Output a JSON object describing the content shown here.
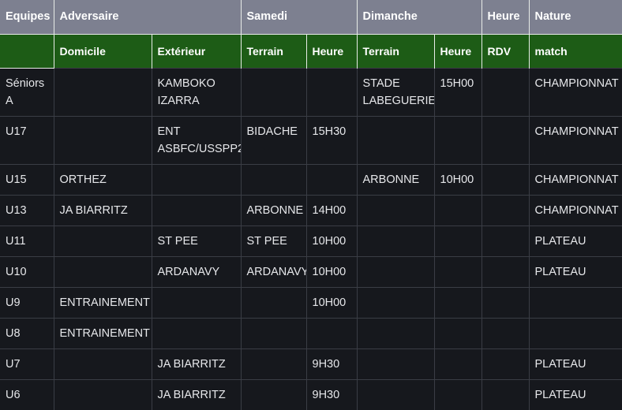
{
  "table": {
    "group_headers": [
      {
        "label": "Equipes",
        "span": 1,
        "rowspan": 2
      },
      {
        "label": "Adversaire",
        "span": 2,
        "rowspan": 1
      },
      {
        "label": "Samedi",
        "span": 2,
        "rowspan": 1
      },
      {
        "label": "Dimanche",
        "span": 2,
        "rowspan": 1
      },
      {
        "label": "Heure",
        "span": 1,
        "rowspan": 1
      },
      {
        "label": "Nature",
        "span": 1,
        "rowspan": 1
      }
    ],
    "sub_headers": [
      "Domicile",
      "Extérieur",
      "Terrain",
      "Heure",
      "Terrain",
      "Heure",
      "RDV",
      "match"
    ],
    "rows": [
      {
        "equipe": "Séniors A",
        "domicile": "",
        "exterieur": "KAMBOKO IZARRA",
        "samedi_terrain": "",
        "samedi_heure": "",
        "dimanche_terrain": "STADE LABEGUERIE",
        "dimanche_heure": "15H00",
        "rdv": "",
        "nature": "CHAMPIONNAT"
      },
      {
        "equipe": "U17",
        "domicile": "",
        "exterieur": "ENT ASBFC/USSPP2",
        "samedi_terrain": "BIDACHE",
        "samedi_heure": "15H30",
        "dimanche_terrain": "",
        "dimanche_heure": "",
        "rdv": "",
        "nature": "CHAMPIONNAT"
      },
      {
        "equipe": "U15",
        "domicile": "ORTHEZ",
        "exterieur": "",
        "samedi_terrain": "",
        "samedi_heure": "",
        "dimanche_terrain": "ARBONNE",
        "dimanche_heure": "10H00",
        "rdv": "",
        "nature": "CHAMPIONNAT"
      },
      {
        "equipe": "U13",
        "domicile": "JA BIARRITZ",
        "exterieur": "",
        "samedi_terrain": "ARBONNE",
        "samedi_heure": "14H00",
        "dimanche_terrain": "",
        "dimanche_heure": "",
        "rdv": "",
        "nature": "CHAMPIONNAT"
      },
      {
        "equipe": "U11",
        "domicile": "",
        "exterieur": "ST PEE",
        "samedi_terrain": "ST PEE",
        "samedi_heure": "10H00",
        "dimanche_terrain": "",
        "dimanche_heure": "",
        "rdv": "",
        "nature": "PLATEAU"
      },
      {
        "equipe": "U10",
        "domicile": "",
        "exterieur": "ARDANAVY",
        "samedi_terrain": "ARDANAVY",
        "samedi_heure": "10H00",
        "dimanche_terrain": "",
        "dimanche_heure": "",
        "rdv": "",
        "nature": "PLATEAU"
      },
      {
        "equipe": "U9",
        "domicile": "ENTRAINEMENT",
        "exterieur": "",
        "samedi_terrain": "",
        "samedi_heure": "10H00",
        "dimanche_terrain": "",
        "dimanche_heure": "",
        "rdv": "",
        "nature": ""
      },
      {
        "equipe": "U8",
        "domicile": "ENTRAINEMENT",
        "exterieur": "",
        "samedi_terrain": "",
        "samedi_heure": "",
        "dimanche_terrain": "",
        "dimanche_heure": "",
        "rdv": "",
        "nature": ""
      },
      {
        "equipe": "U7",
        "domicile": "",
        "exterieur": "JA BIARRITZ",
        "samedi_terrain": "",
        "samedi_heure": "9H30",
        "dimanche_terrain": "",
        "dimanche_heure": "",
        "rdv": "",
        "nature": "PLATEAU"
      },
      {
        "equipe": "U6",
        "domicile": "",
        "exterieur": "JA BIARRITZ",
        "samedi_terrain": "",
        "samedi_heure": "9H30",
        "dimanche_terrain": "",
        "dimanche_heure": "",
        "rdv": "",
        "nature": "PLATEAU"
      }
    ]
  },
  "colors": {
    "group_header_bg": "#7d8090",
    "sub_header_bg": "#1d5c16",
    "body_bg": "#16181d",
    "body_text": "#e6e7ea",
    "grid_line": "#3a3d45",
    "header_grid_line": "#e8ece8"
  }
}
